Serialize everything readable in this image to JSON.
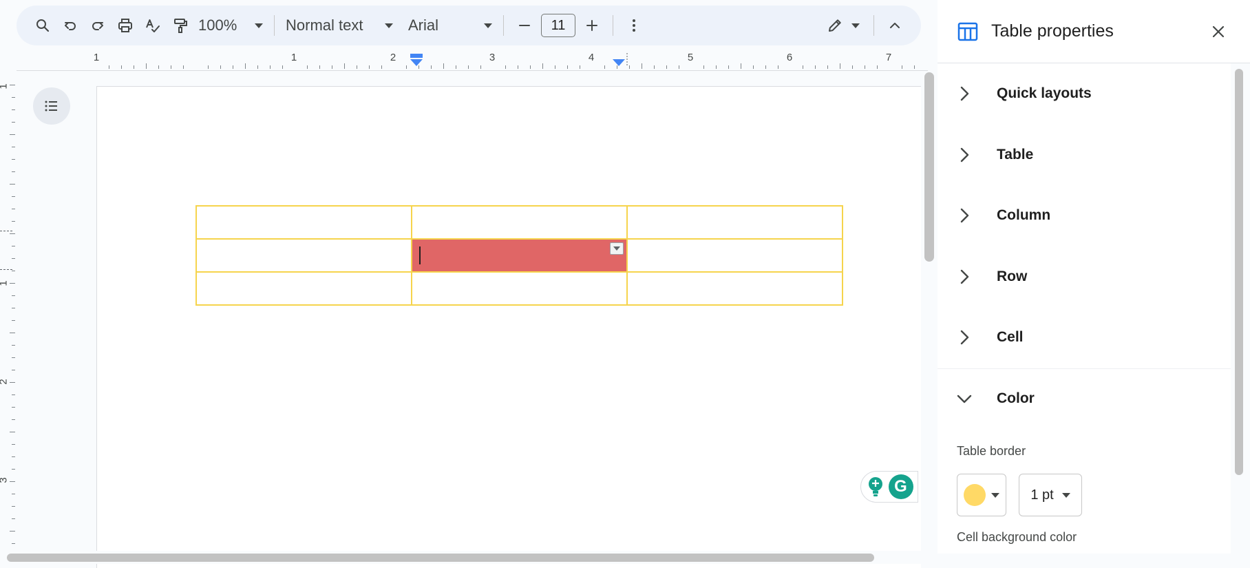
{
  "toolbar": {
    "zoom": "100%",
    "paragraph_style": "Normal text",
    "font": "Arial",
    "font_size": "11"
  },
  "ruler": {
    "horizontal_numbers": [
      "1",
      "1",
      "2",
      "3",
      "4",
      "5",
      "6",
      "7"
    ],
    "vertical_numbers": [
      "1",
      "1",
      "2",
      "3"
    ]
  },
  "document": {
    "table": {
      "rows": 3,
      "cols": 3,
      "border_color": "#f6d44c",
      "active_cell_color": "#e06666"
    }
  },
  "grammarly": {
    "logo_letter": "G"
  },
  "panel": {
    "title": "Table properties",
    "sections": [
      {
        "label": "Quick layouts"
      },
      {
        "label": "Table"
      },
      {
        "label": "Column"
      },
      {
        "label": "Row"
      },
      {
        "label": "Cell"
      }
    ],
    "color_section": {
      "label": "Color",
      "table_border_label": "Table border",
      "border_color": "#ffd966",
      "border_width": "1 pt",
      "cell_background_label": "Cell background color"
    }
  }
}
